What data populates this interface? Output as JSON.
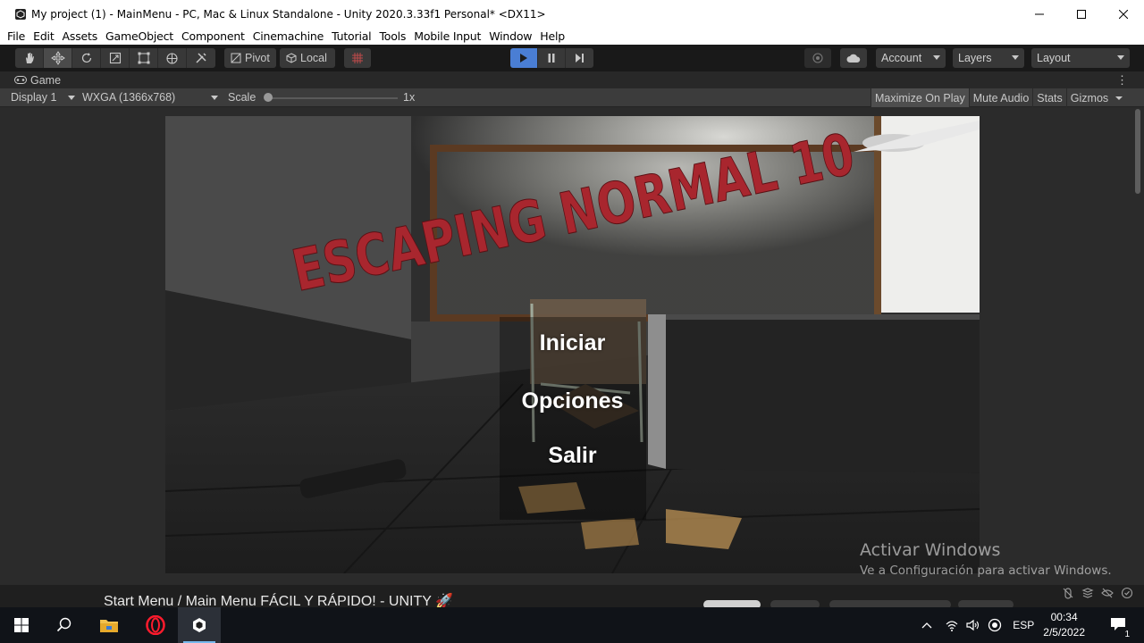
{
  "window": {
    "title": "My project (1) - MainMenu - PC, Mac & Linux Standalone - Unity 2020.3.33f1 Personal* <DX11>"
  },
  "menubar": [
    "File",
    "Edit",
    "Assets",
    "GameObject",
    "Component",
    "Cinemachine",
    "Tutorial",
    "Tools",
    "Mobile Input",
    "Window",
    "Help"
  ],
  "toolbar": {
    "tools": [
      "hand-tool-icon",
      "move-tool-icon",
      "rotate-tool-icon",
      "scale-tool-icon",
      "rect-tool-icon",
      "transform-tool-icon",
      "custom-tool-icon"
    ],
    "pivot_label": "Pivot",
    "local_label": "Local",
    "account_label": "Account",
    "layers_label": "Layers",
    "layout_label": "Layout",
    "play_active_color": "#4a7ed4"
  },
  "game_tab": {
    "title": "Game",
    "display": "Display 1",
    "resolution": "WXGA (1366x768)",
    "scale_label": "Scale",
    "scale_value": "1x",
    "toggles": [
      "Maximize On Play",
      "Mute Audio",
      "Stats",
      "Gizmos"
    ]
  },
  "game_view": {
    "logo_text": "ESCAPING NORMAL 10",
    "logo_color": "#a8262e",
    "menu": [
      "Iniciar",
      "Opciones",
      "Salir"
    ]
  },
  "watermark": {
    "line1": "Activar Windows",
    "line2": "Ve a Configuración para activar Windows."
  },
  "bottom_strip": {
    "caption": "Start Menu / Main Menu FÁCIL Y RÁPIDO! - UNITY 🚀"
  },
  "taskbar": {
    "language": "ESP",
    "time": "00:34",
    "date": "2/5/2022",
    "notification_count": "1"
  }
}
